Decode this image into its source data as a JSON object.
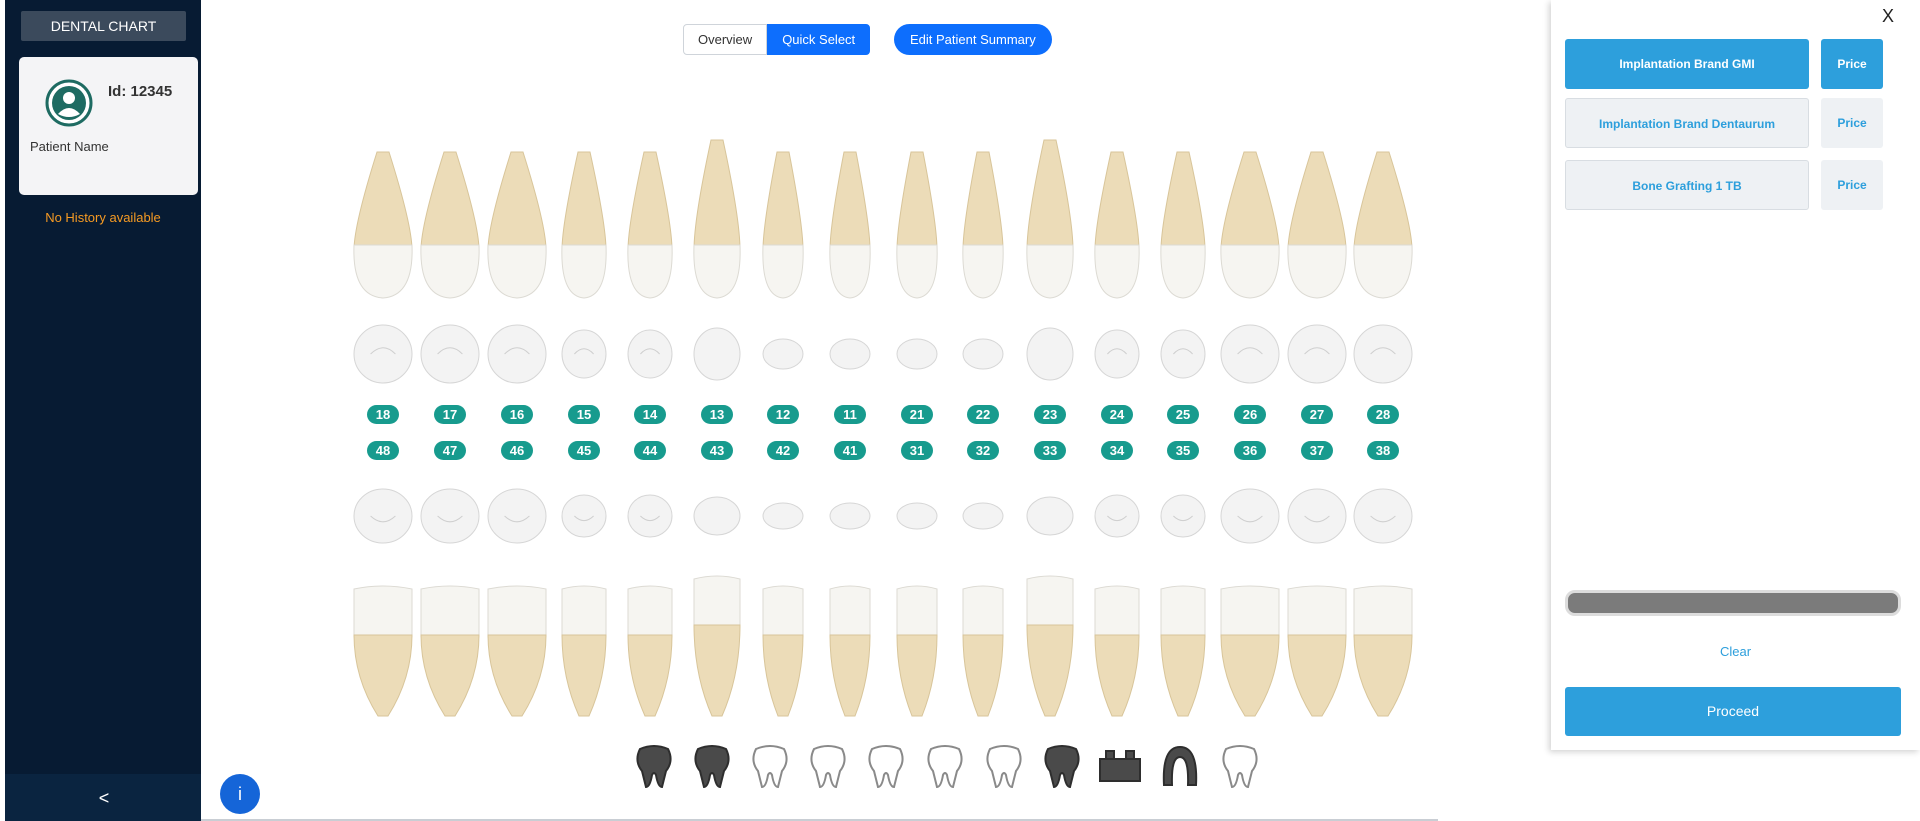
{
  "sidebar": {
    "title": "DENTAL CHART",
    "patient_id": "Id: 12345",
    "patient_name": "Patient Name",
    "history_text": "No History available",
    "collapse_icon": "<"
  },
  "toolbar": {
    "tabs": [
      "Overview",
      "Quick Select"
    ],
    "selected_tab": "Quick Select",
    "edit_summary_label": "Edit Patient Summary"
  },
  "upper_teeth": [
    "18",
    "17",
    "16",
    "15",
    "14",
    "13",
    "12",
    "11",
    "21",
    "22",
    "23",
    "24",
    "25",
    "26",
    "27",
    "28"
  ],
  "lower_teeth": [
    "48",
    "47",
    "46",
    "45",
    "44",
    "43",
    "42",
    "41",
    "31",
    "32",
    "33",
    "34",
    "35",
    "36",
    "37",
    "38"
  ],
  "tools": [
    "tooth-surgery-icon",
    "tooth-cleaning-icon",
    "root-canal-icon",
    "tooth-drill-icon",
    "implant-icon",
    "tooth-extraction-icon",
    "braces-icon",
    "gum-icon",
    "bridge-icon",
    "denture-icon",
    "crown-icon"
  ],
  "info_icon": "i",
  "panel": {
    "close_label": "X",
    "procedures": [
      {
        "label": "Implantation Brand GMI",
        "price_label": "Price",
        "active": true
      },
      {
        "label": "Implantation Brand Dentaurum",
        "price_label": "Price",
        "active": false
      },
      {
        "label": "Bone Grafting 1 TB",
        "price_label": "Price",
        "active": false
      }
    ],
    "clear_label": "Clear",
    "proceed_label": "Proceed"
  },
  "colors": {
    "accent": "#0d6efd",
    "sidebar": "#071b33",
    "badge": "#179b8e",
    "panel_accent": "#2d9fdc",
    "warning": "#f59a23"
  }
}
